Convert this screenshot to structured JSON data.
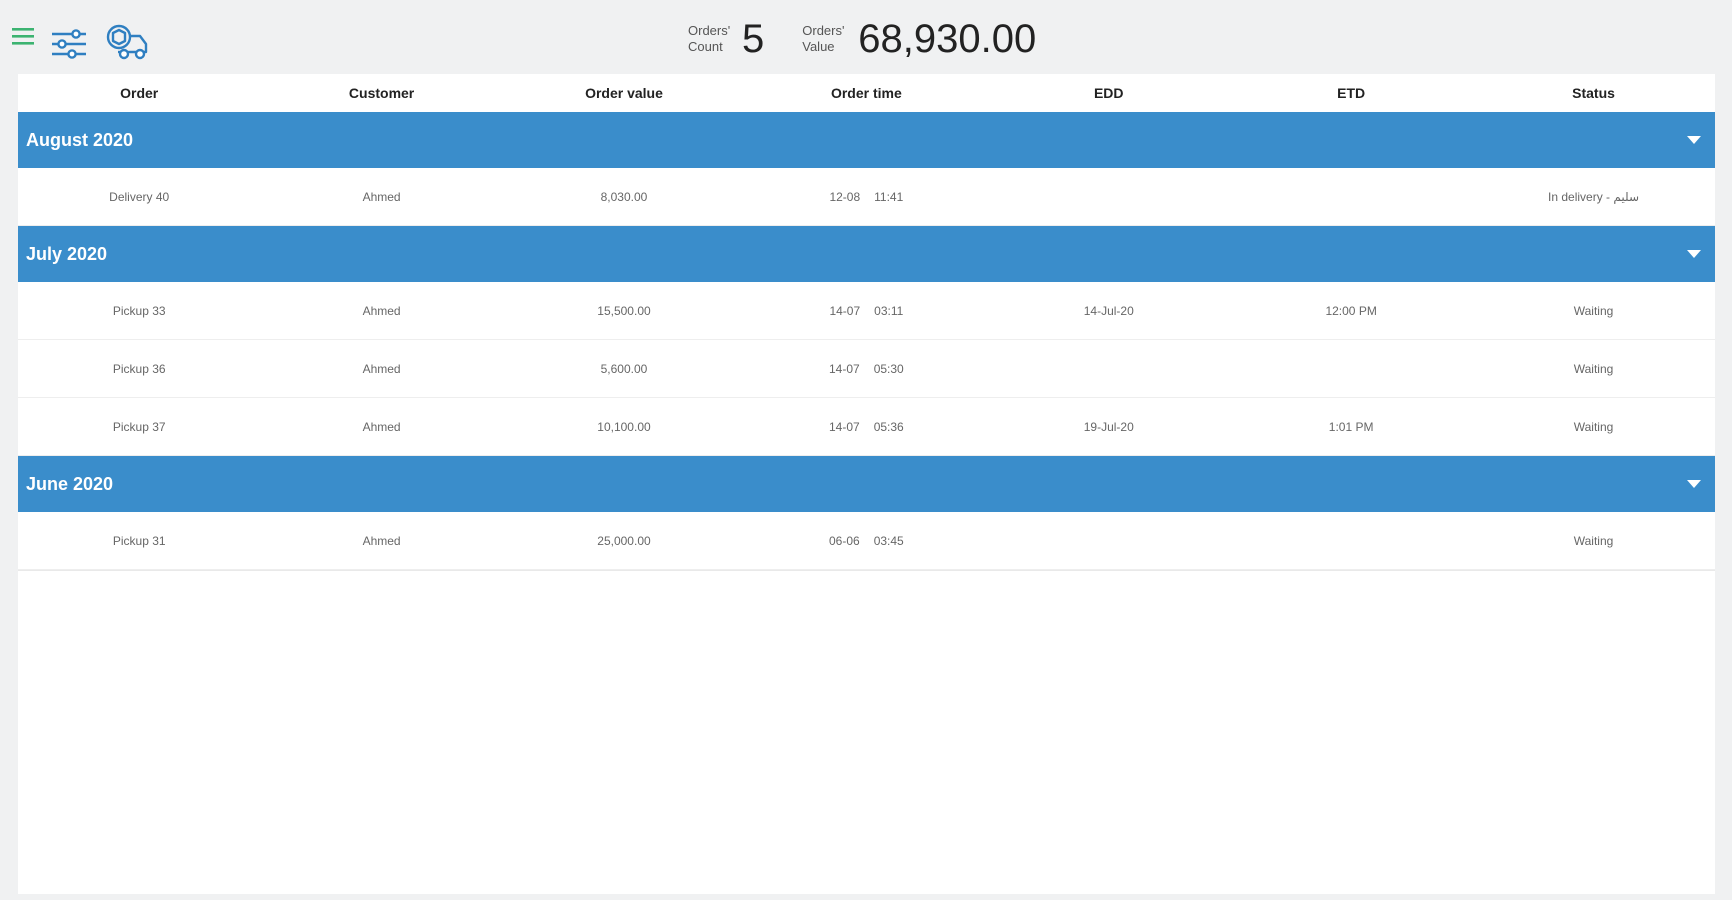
{
  "stats": {
    "count_label_1": "Orders'",
    "count_label_2": "Count",
    "count_value": "5",
    "value_label_1": "Orders'",
    "value_label_2": "Value",
    "value_value": "68,930.00"
  },
  "icons": {
    "menu": "hamburger-menu-icon",
    "filter": "filter-sliders-icon",
    "truck": "delivery-truck-icon"
  },
  "colors": {
    "group_bar": "#3a8dcb",
    "menu_icon": "#3cb371",
    "icon_blue": "#2f7fc1"
  },
  "table": {
    "headers": [
      "Order",
      "Customer",
      "Order value",
      "Order time",
      "EDD",
      "ETD",
      "Status"
    ],
    "groups": [
      {
        "title": "August 2020",
        "rows": [
          {
            "order": "Delivery  40",
            "customer": "Ahmed",
            "value": "8,030.00",
            "date": "12-08",
            "time": "11:41",
            "edd": "",
            "etd": "",
            "status": "In delivery - سليم"
          }
        ]
      },
      {
        "title": "July 2020",
        "rows": [
          {
            "order": "Pickup  33",
            "customer": "Ahmed",
            "value": "15,500.00",
            "date": "14-07",
            "time": "03:11",
            "edd": "14-Jul-20",
            "etd": "12:00 PM",
            "status": "Waiting"
          },
          {
            "order": "Pickup  36",
            "customer": "Ahmed",
            "value": "5,600.00",
            "date": "14-07",
            "time": "05:30",
            "edd": "",
            "etd": "",
            "status": "Waiting"
          },
          {
            "order": "Pickup  37",
            "customer": "Ahmed",
            "value": "10,100.00",
            "date": "14-07",
            "time": "05:36",
            "edd": "19-Jul-20",
            "etd": "1:01 PM",
            "status": "Waiting"
          }
        ]
      },
      {
        "title": "June 2020",
        "rows": [
          {
            "order": "Pickup  31",
            "customer": "Ahmed",
            "value": "25,000.00",
            "date": "06-06",
            "time": "03:45",
            "edd": "",
            "etd": "",
            "status": "Waiting"
          }
        ]
      }
    ]
  }
}
